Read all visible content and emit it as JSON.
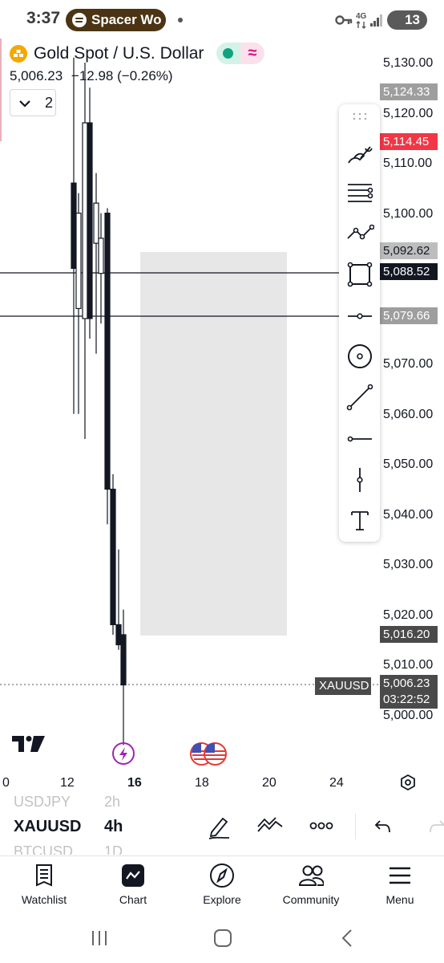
{
  "status_bar": {
    "time": "3:37",
    "media_app": "Spacer Wo",
    "network": "4G",
    "battery": "13"
  },
  "chart": {
    "symbol_name": "Gold Spot / U.S. Dollar",
    "last_price": "5,006.23",
    "change": "−12.98 (−0.26%)",
    "collapse_count": "2",
    "price_axis": [
      "5,130.00",
      "5,120.00",
      "5,110.00",
      "5,100.00",
      "5,070.00",
      "5,060.00",
      "5,050.00",
      "5,040.00",
      "5,030.00",
      "5,020.00",
      "5,010.00",
      "5,000.00"
    ],
    "price_tags": [
      {
        "label": "5,124.33",
        "color": "#9e9e9e"
      },
      {
        "label": "5,114.45",
        "color": "#f23645"
      },
      {
        "label": "5,092.62",
        "color": "#bdbdbd"
      },
      {
        "label": "5,088.52",
        "color": "#131722"
      },
      {
        "label": "5,079.66",
        "color": "#9e9e9e"
      },
      {
        "label": "5,016.20",
        "color": "#4a4a4a"
      }
    ],
    "symbol_tag": "XAUUSD",
    "current_price_tag": "5,006.23",
    "countdown": "03:22:52",
    "time_axis": [
      "0",
      "12",
      "16",
      "18",
      "20",
      "24"
    ],
    "chart_data": {
      "type": "candlestick",
      "symbol": "XAUUSD",
      "interval": "4h",
      "candles": [
        {
          "o": 5106,
          "h": 5131,
          "l": 5060,
          "c": 5089
        },
        {
          "o": 5079,
          "h": 5130,
          "l": 5055,
          "c": 5118
        },
        {
          "o": 5118,
          "h": 5125,
          "l": 5075,
          "c": 5079
        },
        {
          "o": 5081,
          "h": 5104,
          "l": 5060,
          "c": 5100
        },
        {
          "o": 5094,
          "h": 5108,
          "l": 5072,
          "c": 5102
        },
        {
          "o": 5088,
          "h": 5100,
          "l": 5078,
          "c": 5095
        },
        {
          "o": 5100,
          "h": 5101,
          "l": 5038,
          "c": 5045
        },
        {
          "o": 5045,
          "h": 5048,
          "l": 5016,
          "c": 5018
        },
        {
          "o": 5018,
          "h": 5033,
          "l": 5013,
          "c": 5014
        },
        {
          "o": 5016,
          "h": 5021,
          "l": 4994,
          "c": 5006
        }
      ],
      "ylim": [
        4998,
        5131
      ]
    }
  },
  "symbol_bar": {
    "prev_symbol": "USDJPY",
    "prev_tf": "2h",
    "symbol": "XAUUSD",
    "tf": "4h",
    "next_symbol": "BTCUSD",
    "next_tf": "1D"
  },
  "bottom_nav": [
    {
      "label": "Watchlist"
    },
    {
      "label": "Chart"
    },
    {
      "label": "Explore"
    },
    {
      "label": "Community"
    },
    {
      "label": "Menu"
    }
  ]
}
